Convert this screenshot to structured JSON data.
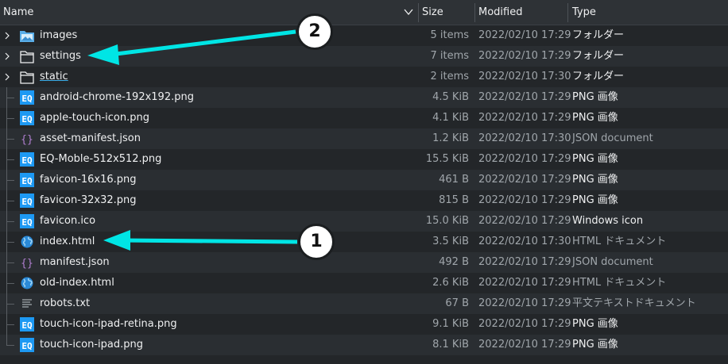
{
  "header": {
    "name": "Name",
    "size": "Size",
    "modified": "Modified",
    "type": "Type"
  },
  "rows": [
    {
      "name": "images",
      "size": "5 items",
      "modified": "2022/02/10 17:29",
      "type": "フォルダー",
      "kind": "folder-images"
    },
    {
      "name": "settings",
      "size": "7 items",
      "modified": "2022/02/10 17:29",
      "type": "フォルダー",
      "kind": "folder"
    },
    {
      "name": "static",
      "size": "2 items",
      "modified": "2022/02/10 17:30",
      "type": "フォルダー",
      "kind": "folder"
    },
    {
      "name": "android-chrome-192x192.png",
      "size": "4.5 KiB",
      "modified": "2022/02/10 17:29",
      "type": "PNG 画像",
      "kind": "png"
    },
    {
      "name": "apple-touch-icon.png",
      "size": "4.1 KiB",
      "modified": "2022/02/10 17:29",
      "type": "PNG 画像",
      "kind": "png"
    },
    {
      "name": "asset-manifest.json",
      "size": "1.2 KiB",
      "modified": "2022/02/10 17:30",
      "type": "JSON document",
      "kind": "json"
    },
    {
      "name": "EQ-Moble-512x512.png",
      "size": "15.5 KiB",
      "modified": "2022/02/10 17:29",
      "type": "PNG 画像",
      "kind": "png"
    },
    {
      "name": "favicon-16x16.png",
      "size": "461 B",
      "modified": "2022/02/10 17:29",
      "type": "PNG 画像",
      "kind": "png"
    },
    {
      "name": "favicon-32x32.png",
      "size": "815 B",
      "modified": "2022/02/10 17:29",
      "type": "PNG 画像",
      "kind": "png"
    },
    {
      "name": "favicon.ico",
      "size": "15.0 KiB",
      "modified": "2022/02/10 17:29",
      "type": "Windows icon",
      "kind": "png"
    },
    {
      "name": "index.html",
      "size": "3.5 KiB",
      "modified": "2022/02/10 17:30",
      "type": "HTML ドキュメント",
      "kind": "html"
    },
    {
      "name": "manifest.json",
      "size": "492 B",
      "modified": "2022/02/10 17:29",
      "type": "JSON document",
      "kind": "json"
    },
    {
      "name": "old-index.html",
      "size": "2.6 KiB",
      "modified": "2022/02/10 17:29",
      "type": "HTML ドキュメント",
      "kind": "html"
    },
    {
      "name": "robots.txt",
      "size": "67 B",
      "modified": "2022/02/10 17:29",
      "type": "平文テキストドキュメント",
      "kind": "txt"
    },
    {
      "name": "touch-icon-ipad-retina.png",
      "size": "9.1 KiB",
      "modified": "2022/02/10 17:29",
      "type": "PNG 画像",
      "kind": "png"
    },
    {
      "name": "touch-icon-ipad.png",
      "size": "8.1 KiB",
      "modified": "2022/02/10 17:29",
      "type": "PNG 画像",
      "kind": "png"
    }
  ],
  "annotations": {
    "one": "1",
    "two": "2"
  },
  "png_icon_text": "EQ",
  "json_icon_text": "{}",
  "colors": {
    "accent": "#3daee9",
    "arrow": "#00e5e5",
    "background": "#232629"
  }
}
